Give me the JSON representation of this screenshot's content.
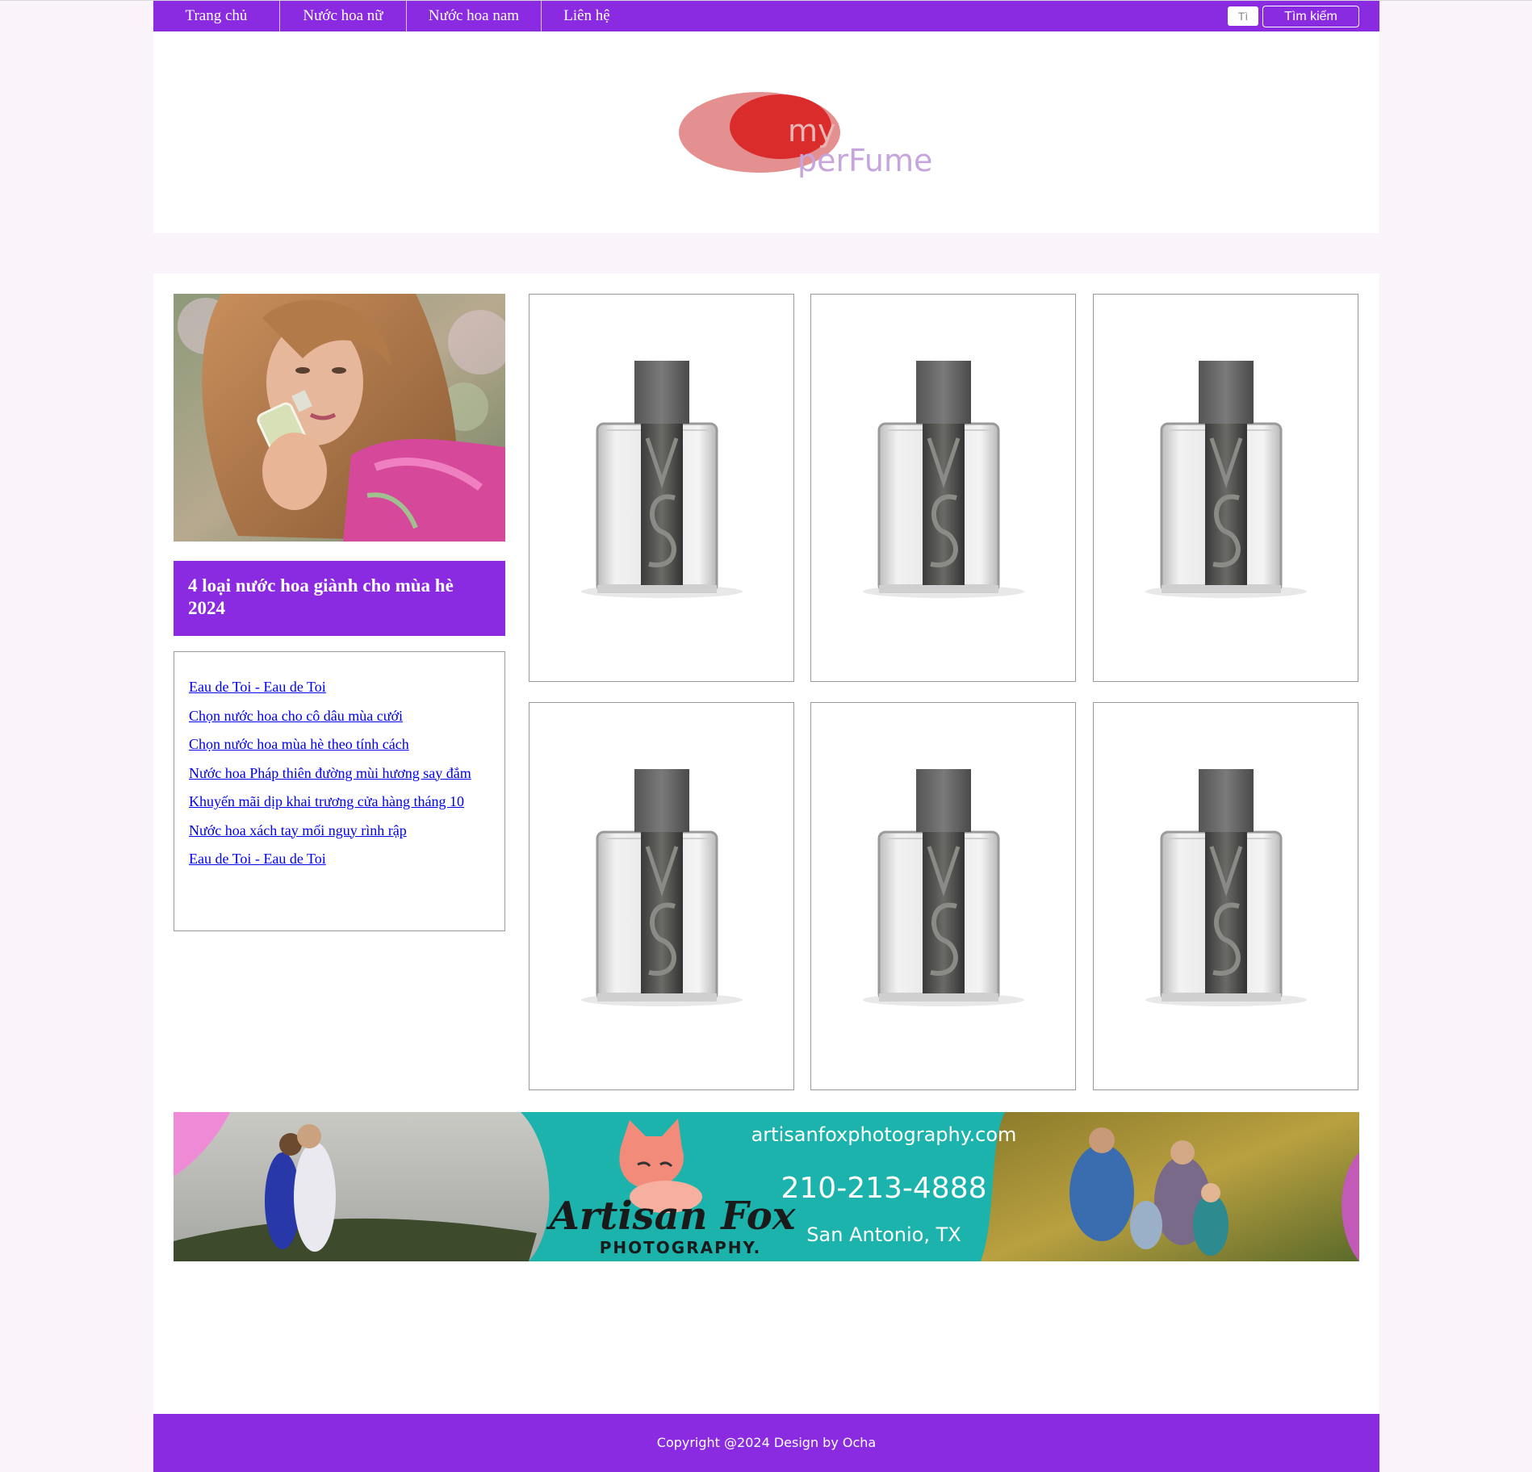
{
  "nav": {
    "items": [
      {
        "label": "Trang chủ"
      },
      {
        "label": "Nước hoa nữ"
      },
      {
        "label": "Nước hoa nam"
      },
      {
        "label": "Liên hệ"
      }
    ],
    "search_value": "Tì",
    "search_button": "Tìm kiếm"
  },
  "logo": {
    "line1": "my",
    "line2": "perFume"
  },
  "sidebar": {
    "promo_title": "4 loại nước hoa giành cho mùa hè 2024",
    "articles": [
      "Eau de Toi - Eau de Toi",
      "Chọn nước hoa cho cô dâu mùa cưới",
      "Chọn nước hoa mùa hè theo tính cách",
      "Nước hoa Pháp thiên đường mùi hương say đắm",
      "Khuyến mãi dịp khai trương cửa hàng tháng 10",
      "Nước hoa xách tay mối nguy rình rập",
      "Eau de Toi - Eau de Toi"
    ]
  },
  "products": [
    {
      "image": "vs-perfume-bottle"
    },
    {
      "image": "vs-perfume-bottle"
    },
    {
      "image": "vs-perfume-bottle"
    },
    {
      "image": "vs-perfume-bottle"
    },
    {
      "image": "vs-perfume-bottle"
    },
    {
      "image": "vs-perfume-bottle"
    }
  ],
  "ad": {
    "website": "artisanfoxphotography.com",
    "phone": "210-213-4888",
    "location": "San Antonio, TX",
    "brand": "Artisan Fox",
    "brand_sub": "PHOTOGRAPHY."
  },
  "footer": {
    "copyright": "Copyright @2024 Design by Ocha"
  },
  "colors": {
    "accent": "#8a2be2",
    "page_background": "#faf4fa",
    "ad_teal": "#1bb3ab"
  }
}
